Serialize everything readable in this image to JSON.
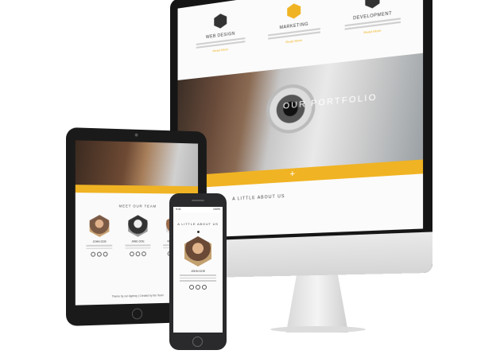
{
  "imac": {
    "features": [
      {
        "icon": "pen-icon",
        "title": "WEB DESIGN",
        "more": "Read More"
      },
      {
        "icon": "star-icon",
        "title": "MARKETING",
        "more": "Read More"
      },
      {
        "icon": "gear-icon",
        "title": "DEVELOPMENT",
        "more": "Read More"
      }
    ],
    "portfolio_label": "OUR PORTFOLIO",
    "plus_glyph": "+",
    "about_label": "A LITTLE ABOUT US"
  },
  "ipad": {
    "plus_glyph": "+",
    "team_heading": "MEET OUR TEAM",
    "members": [
      {
        "name": "JOHN DOE"
      },
      {
        "name": "JANE DOE"
      },
      {
        "name": "MARK SMITH"
      }
    ],
    "footer": "Theme by our Agency | Created by the Team"
  },
  "iphone": {
    "status_time": "9:41",
    "status_battery": "100%",
    "about_label": "A LITTLE ABOUT US",
    "member_name": "JOHN DOE"
  },
  "colors": {
    "accent": "#f0b323",
    "device_dark": "#1a1a1a"
  }
}
